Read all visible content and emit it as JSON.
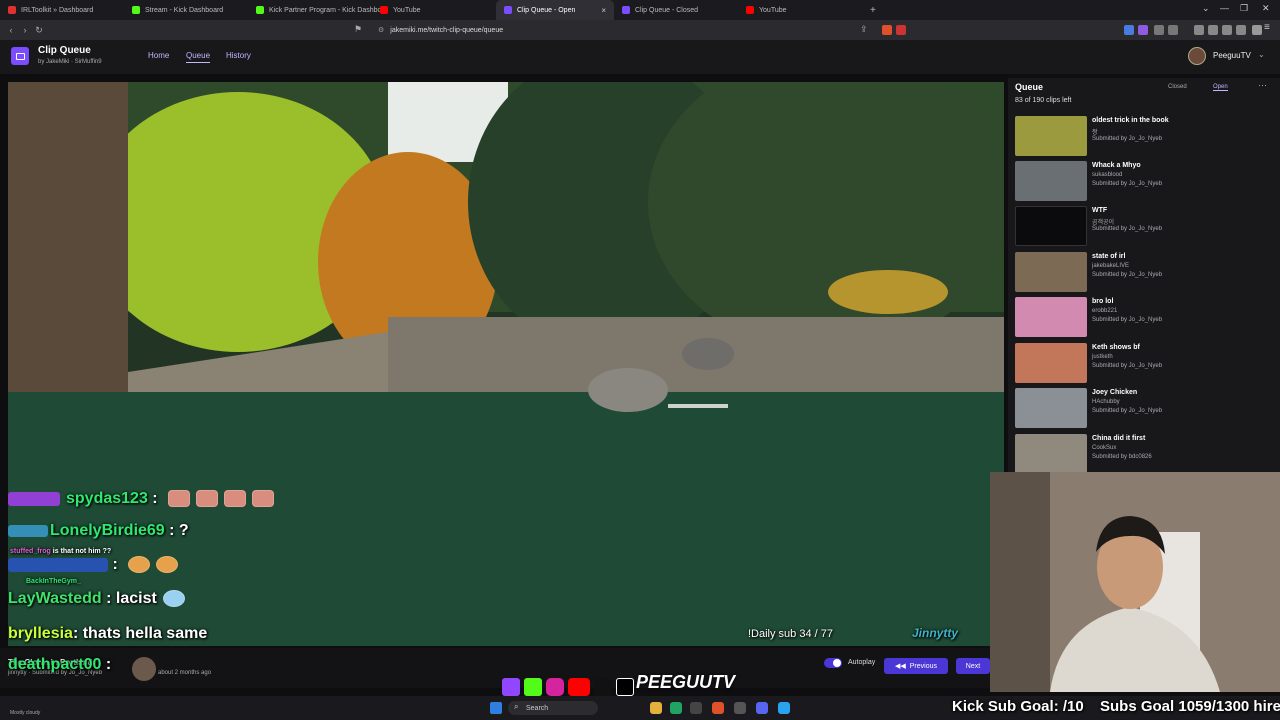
{
  "tabs": [
    {
      "label": "IRLToolkit » Dashboard",
      "color": "#e03030"
    },
    {
      "label": "Stream - Kick Dashboard",
      "color": "#53fc18"
    },
    {
      "label": "Kick Partner Program - Kick Dashbo...",
      "color": "#53fc18"
    },
    {
      "label": "YouTube",
      "color": "#ff0000"
    },
    {
      "label": "Clip Queue - Open",
      "color": "#7c4dff",
      "close": "×"
    },
    {
      "label": "Clip Queue - Closed",
      "color": "#7c4dff"
    },
    {
      "label": "YouTube",
      "color": "#ff0000"
    }
  ],
  "new_tab": "+",
  "window_controls": [
    "⌄",
    "—",
    "❐",
    "✕"
  ],
  "address": {
    "url": "jakemiki.me/twitch-clip-queue/queue"
  },
  "app": {
    "title": "Clip Queue",
    "by": "by",
    "authors": "JakeMiki · SirMuffin9",
    "nav": [
      "Home",
      "Queue",
      "History"
    ],
    "user": "PeeguuTV"
  },
  "queue": {
    "heading": "Queue",
    "count": "83 of 190 clips left",
    "closed_label": "Closed",
    "open_label": "Open",
    "menu": "⋯",
    "items": [
      {
        "title": "oldest trick in the book",
        "channel": "짱",
        "submitted": "Submitted by Jo_Jo_Nyeb",
        "tone": "#9c9a3e"
      },
      {
        "title": "Whack a Mhyo",
        "channel": "sukasblood",
        "submitted": "Submitted by Jo_Jo_Nyeb",
        "tone": "#6a6f74"
      },
      {
        "title": "WTF",
        "channel": "곰객공이",
        "submitted": "Submitted by Jo_Jo_Nyeb",
        "tone": "#0b0b0d"
      },
      {
        "title": "state of irl",
        "channel": "jakebakeLIVE",
        "submitted": "Submitted by Jo_Jo_Nyeb",
        "tone": "#7d6a55"
      },
      {
        "title": "bro lol",
        "channel": "erobb221",
        "submitted": "Submitted by Jo_Jo_Nyeb",
        "tone": "#d28ab0"
      },
      {
        "title": "Keth shows bf",
        "channel": "justketh",
        "submitted": "Submitted by Jo_Jo_Nyeb",
        "tone": "#c3775a"
      },
      {
        "title": "Joey Chicken",
        "channel": "HAchubby",
        "submitted": "Submitted by Jo_Jo_Nyeb",
        "tone": "#8b9096"
      },
      {
        "title": "China did it first",
        "channel": "CookSux",
        "submitted": "Submitted by bdc0826",
        "tone": "#8f8a7d"
      }
    ]
  },
  "chat": [
    {
      "user": "spydas123",
      "sep": " : ",
      "msg": "",
      "color": "#2ee870"
    },
    {
      "user": "LonelyBirdie69",
      "sep": " : ",
      "msg": "?",
      "color": "#2ee870"
    },
    {
      "user": "LayWastedd",
      "sep": " : ",
      "msg": "lacist",
      "color": "#3fe36b"
    },
    {
      "user": "bryllesia",
      "sep": ": ",
      "msg": "thats hella same",
      "color": "#c8ff3a"
    },
    {
      "user": "deathpact00",
      "sep": " : ",
      "msg": "",
      "color": "#2ee870"
    }
  ],
  "chat_small": [
    {
      "user": "stuffed_frog",
      "msg": "is that not him ??"
    },
    {
      "user": "BackInTheGym_",
      "msg": ""
    }
  ],
  "overlay": {
    "daily_sub": "!Daily sub 34 / 77",
    "name": "Jinnytty",
    "kick_goal": "Kick Sub Goal: /10",
    "subs_goal": "Subs Goal 1059/1300 hire",
    "brand": "PEEGUUTV",
    "weather": "Mostly cloudy"
  },
  "player": {
    "clip_title": "The Clown in Portland",
    "submeta": "jinnytty · Submitted by Jo_Jo_Nyeb",
    "date": "about 2 months ago",
    "autoplay": "Autoplay",
    "previous": "Previous",
    "next": "Next"
  },
  "taskbar": {
    "search": "Search"
  }
}
